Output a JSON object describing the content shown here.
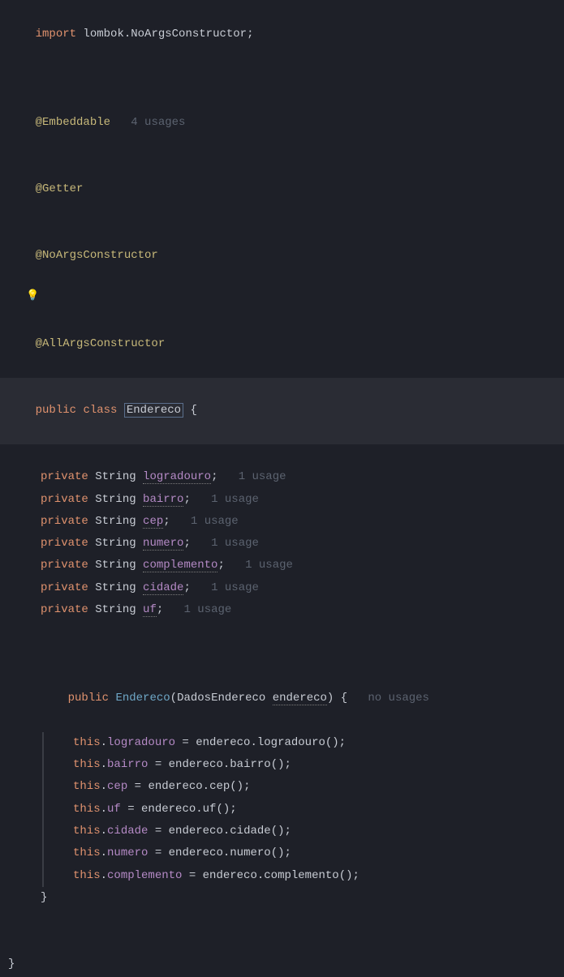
{
  "import": {
    "keyword": "import",
    "path_prefix": " lombok.",
    "clazz": "NoArgsConstructor",
    "semi": ";"
  },
  "annotations": {
    "embeddable": "@Embeddable",
    "embeddable_usage": "4 usages",
    "getter": "@Getter",
    "noargs": "@NoArgsConstructor",
    "allargs": "@AllArgsConstructor"
  },
  "class_decl": {
    "public": "public",
    "class_kw": "class",
    "name": "Endereco",
    "brace": " {"
  },
  "fields": [
    {
      "mod": "private",
      "type": "String",
      "name": "logradouro",
      "usage": "1 usage"
    },
    {
      "mod": "private",
      "type": "String",
      "name": "bairro",
      "usage": "1 usage"
    },
    {
      "mod": "private",
      "type": "String",
      "name": "cep",
      "usage": "1 usage"
    },
    {
      "mod": "private",
      "type": "String",
      "name": "numero",
      "usage": "1 usage"
    },
    {
      "mod": "private",
      "type": "String",
      "name": "complemento",
      "usage": "1 usage"
    },
    {
      "mod": "private",
      "type": "String",
      "name": "cidade",
      "usage": "1 usage"
    },
    {
      "mod": "private",
      "type": "String",
      "name": "uf",
      "usage": "1 usage"
    }
  ],
  "ctor": {
    "public": "public",
    "name": "Endereco",
    "param_type": "DadosEndereco",
    "param_name": "endereco",
    "usage": "no usages",
    "open": "(",
    "close_paren_brace": ") {",
    "assignments": [
      {
        "this": "this",
        "field": "logradouro",
        "expr_prefix": " = endereco.",
        "method": "logradouro",
        "suffix": "();"
      },
      {
        "this": "this",
        "field": "bairro",
        "expr_prefix": " = endereco.",
        "method": "bairro",
        "suffix": "();"
      },
      {
        "this": "this",
        "field": "cep",
        "expr_prefix": " = endereco.",
        "method": "cep",
        "suffix": "();"
      },
      {
        "this": "this",
        "field": "uf",
        "expr_prefix": " = endereco.",
        "method": "uf",
        "suffix": "();"
      },
      {
        "this": "this",
        "field": "cidade",
        "expr_prefix": " = endereco.",
        "method": "cidade",
        "suffix": "();"
      },
      {
        "this": "this",
        "field": "numero",
        "expr_prefix": " = endereco.",
        "method": "numero",
        "suffix": "();"
      },
      {
        "this": "this",
        "field": "complemento",
        "expr_prefix": " = endereco.",
        "method": "complemento",
        "suffix": "();"
      }
    ],
    "close_brace": "}"
  },
  "class_close": "}",
  "icons": {
    "bulb": "💡"
  }
}
